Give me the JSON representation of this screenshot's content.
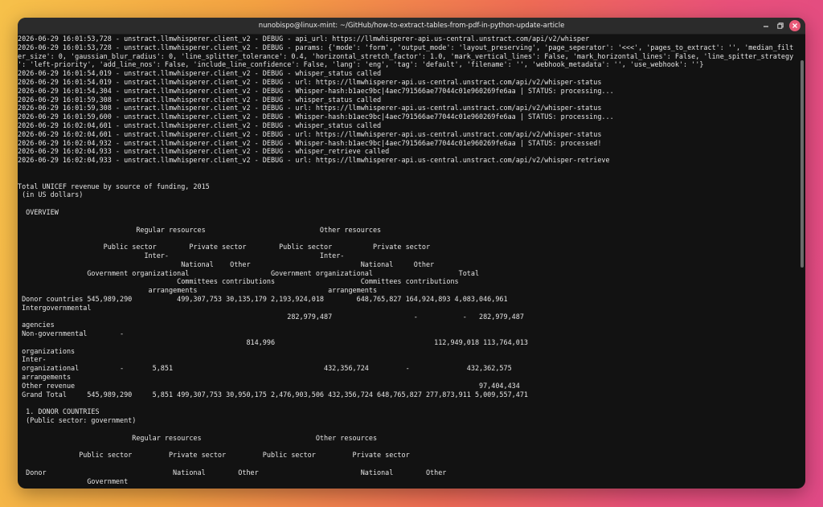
{
  "window": {
    "title": "nunobispo@linux-mint: ~/GitHub/how-to-extract-tables-from-pdf-in-python-update-article"
  },
  "icons": {
    "minimize": "minimize-icon",
    "maximize": "maximize-icon",
    "close": "close-icon"
  },
  "colors": {
    "terminal_bg": "#121212",
    "titlebar_bg": "#2b2b2b",
    "terminal_text": "#e4e4e4",
    "close_button": "#e95a78"
  },
  "terminal": {
    "lines": [
      "2026-06-29 16:01:53,728 - unstract.llmwhisperer.client_v2 - DEBUG - api_url: https://llmwhisperer-api.us-central.unstract.com/api/v2/whisper",
      "2026-06-29 16:01:53,728 - unstract.llmwhisperer.client_v2 - DEBUG - params: {'mode': 'form', 'output_mode': 'layout_preserving', 'page_seperator': '<<<', 'pages_to_extract': '', 'median_filt",
      "er_size': 0, 'gaussian_blur_radius': 0, 'line_splitter_tolerance': 0.4, 'horizontal_stretch_factor': 1.0, 'mark_vertical_lines': False, 'mark_horizontal_lines': False, 'line_spitter_strategy",
      "': 'left-priority', 'add_line_nos': False, 'include_line_confidence': False, 'lang': 'eng', 'tag': 'default', 'filename': '', 'webhook_metadata': '', 'use_webhook': ''}",
      "2026-06-29 16:01:54,019 - unstract.llmwhisperer.client_v2 - DEBUG - whisper_status called",
      "2026-06-29 16:01:54,019 - unstract.llmwhisperer.client_v2 - DEBUG - url: https://llmwhisperer-api.us-central.unstract.com/api/v2/whisper-status",
      "2026-06-29 16:01:54,304 - unstract.llmwhisperer.client_v2 - DEBUG - Whisper-hash:b1aec9bc|4aec791566ae77044c01e960269fe6aa | STATUS: processing...",
      "2026-06-29 16:01:59,308 - unstract.llmwhisperer.client_v2 - DEBUG - whisper_status called",
      "2026-06-29 16:01:59,308 - unstract.llmwhisperer.client_v2 - DEBUG - url: https://llmwhisperer-api.us-central.unstract.com/api/v2/whisper-status",
      "2026-06-29 16:01:59,600 - unstract.llmwhisperer.client_v2 - DEBUG - Whisper-hash:b1aec9bc|4aec791566ae77044c01e960269fe6aa | STATUS: processing...",
      "2026-06-29 16:02:04,601 - unstract.llmwhisperer.client_v2 - DEBUG - whisper_status called",
      "2026-06-29 16:02:04,601 - unstract.llmwhisperer.client_v2 - DEBUG - url: https://llmwhisperer-api.us-central.unstract.com/api/v2/whisper-status",
      "2026-06-29 16:02:04,932 - unstract.llmwhisperer.client_v2 - DEBUG - Whisper-hash:b1aec9bc|4aec791566ae77044c01e960269fe6aa | STATUS: processed!",
      "2026-06-29 16:02:04,933 - unstract.llmwhisperer.client_v2 - DEBUG - whisper_retrieve called",
      "2026-06-29 16:02:04,933 - unstract.llmwhisperer.client_v2 - DEBUG - url: https://llmwhisperer-api.us-central.unstract.com/api/v2/whisper-retrieve",
      "",
      "",
      "Total UNICEF revenue by source of funding, 2015",
      " (in US dollars)",
      "",
      "  OVERVIEW",
      "",
      "                             Regular resources                            Other resources",
      "",
      "                     Public sector        Private sector        Public sector          Private sector",
      "                               Inter-                                     Inter-",
      "                                        National    Other                           National     Other",
      "                 Government organizational                    Government organizational                     Total",
      "                                       Committees contributions                     Committees contributions",
      "                                arrangements                                arrangements",
      " Donor countries 545,989,290           499,307,753 30,135,179 2,193,924,018        648,765,827 164,924,893 4,083,046,961",
      " Intergovernmental",
      "                                                                  282,979,487                    -           -   282,979,487",
      " agencies",
      " Non-governmental        -",
      "                                                        814,996                                       112,949,018 113,764,013",
      " organizations",
      " Inter-",
      " organizational          -       5,851                                     432,356,724         -              432,362,575",
      " arrangements",
      " Other revenue                                                                                                   97,404,434",
      " Grand Total     545,989,290     5,851 499,307,753 30,950,175 2,476,903,506 432,356,724 648,765,827 277,873,911 5,009,557,471",
      "",
      "  1. DONOR COUNTRIES",
      "  (Public sector: government)",
      "",
      "                            Regular resources                            Other resources",
      "",
      "               Public sector         Private sector         Public sector         Private sector",
      "",
      "  Donor                               National        Other                         National        Other",
      "                 Government"
    ]
  }
}
